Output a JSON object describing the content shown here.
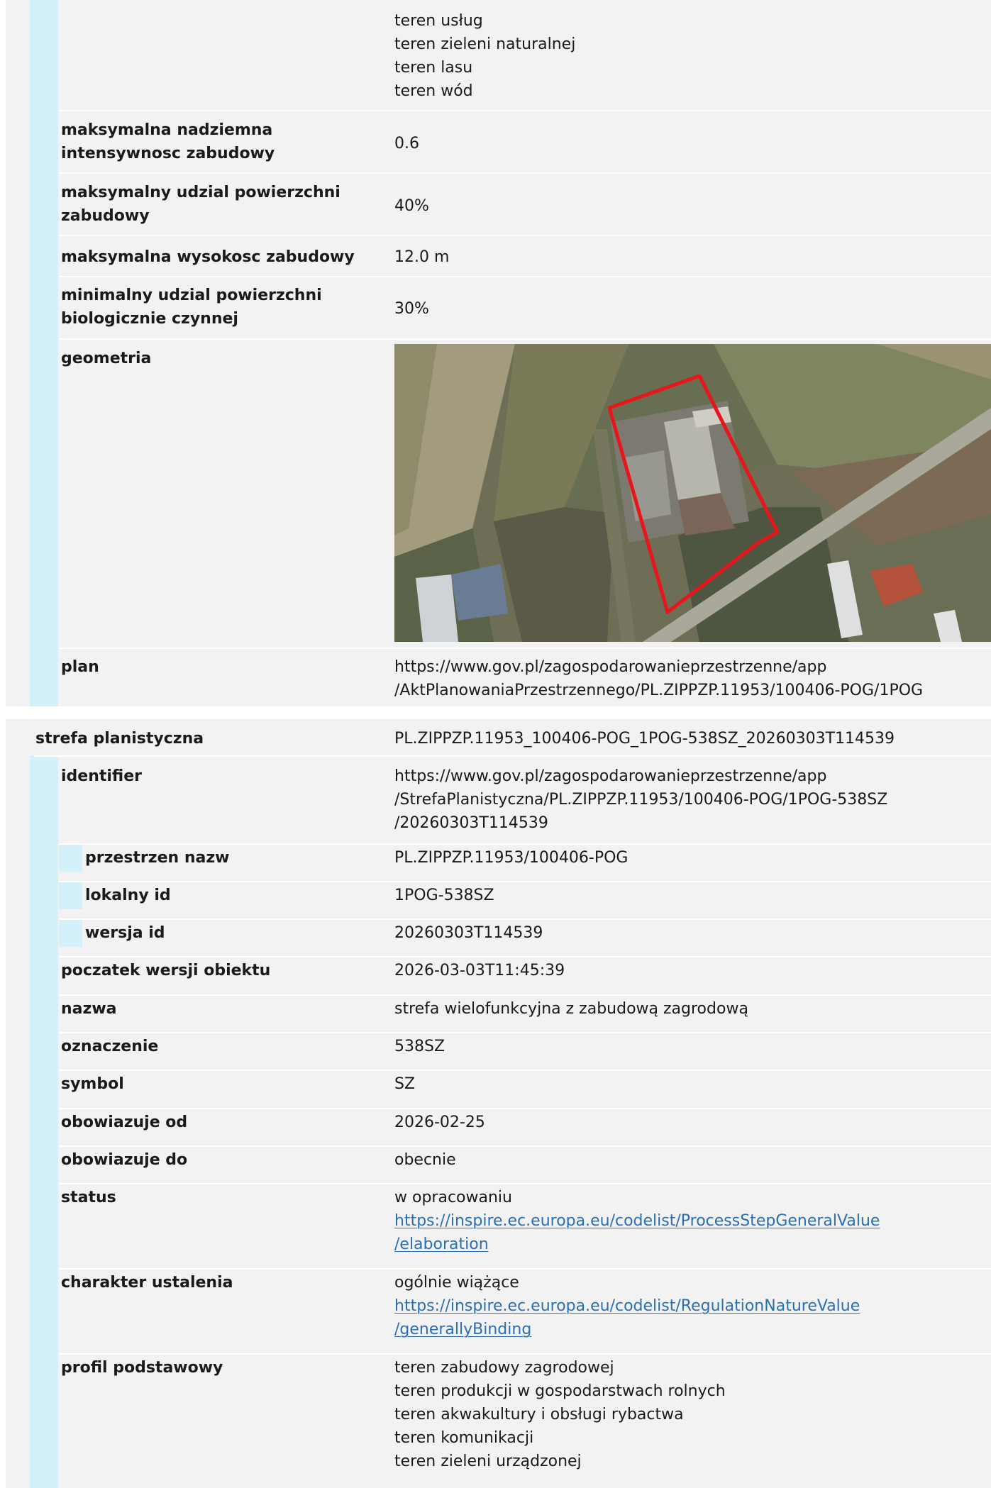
{
  "block1": {
    "top_values": [
      "teren usług",
      "teren zieleni naturalnej",
      "teren lasu",
      "teren wód"
    ],
    "rows": [
      {
        "label": "maksymalna nadziemna intensywnosc zabudowy",
        "value": "0.6"
      },
      {
        "label": "maksymalny udzial powierzchni zabudowy",
        "value": "40%"
      },
      {
        "label": "maksymalna wysokosc zabudowy",
        "value": "12.0 m"
      },
      {
        "label": "minimalny udzial powierzchni biologicznie czynnej",
        "value": "30%"
      }
    ],
    "geometria_label": "geometria",
    "plan_label": "plan",
    "plan_value_line1": "https://www.gov.pl/zagospodarowanieprzestrzenne/app",
    "plan_value_line2": "/AktPlanowaniaPrzestrzennego/PL.ZIPPZP.11953/100406-POG/1POG"
  },
  "block2": {
    "title_label": "strefa planistyczna",
    "title_value": "PL.ZIPPZP.11953_100406-POG_1POG-538SZ_20260303T114539",
    "identifier_label": "identifier",
    "identifier_lines": [
      "https://www.gov.pl/zagospodarowanieprzestrzenne/app",
      "/StrefaPlanistyczna/PL.ZIPPZP.11953/100406-POG/1POG-538SZ",
      "/20260303T114539"
    ],
    "sub_rows": [
      {
        "label": "przestrzen nazw",
        "value": "PL.ZIPPZP.11953/100406-POG"
      },
      {
        "label": "lokalny id",
        "value": "1POG-538SZ"
      },
      {
        "label": "wersja id",
        "value": "20260303T114539"
      }
    ],
    "rows": [
      {
        "label": "poczatek wersji obiektu",
        "value": "2026-03-03T11:45:39"
      },
      {
        "label": "nazwa",
        "value": "strefa wielofunkcyjna z zabudową zagrodową"
      },
      {
        "label": "oznaczenie",
        "value": "538SZ"
      },
      {
        "label": "symbol",
        "value": "SZ"
      },
      {
        "label": "obowiazuje od",
        "value": "2026-02-25"
      },
      {
        "label": "obowiazuje do",
        "value": "obecnie"
      }
    ],
    "status_label": "status",
    "status_value": "w opracowaniu",
    "status_link1": "https://inspire.ec.europa.eu/codelist/ProcessStepGeneralValue",
    "status_link2": "/elaboration",
    "charakter_label": "charakter ustalenia",
    "charakter_value": "ogólnie wiążące",
    "charakter_link1": "https://inspire.ec.europa.eu/codelist/RegulationNatureValue",
    "charakter_link2": "/generallyBinding",
    "profil_label": "profil podstawowy",
    "profil_values": [
      "teren zabudowy zagrodowej",
      "teren produkcji w gospodarstwach rolnych",
      "teren akwakultury i obsługi rybactwa",
      "teren komunikacji",
      "teren zieleni urządzonej"
    ]
  },
  "colors": {
    "stripe": "#d4f1fb",
    "link": "#2a6fb3",
    "polygon": "#e8151b"
  }
}
